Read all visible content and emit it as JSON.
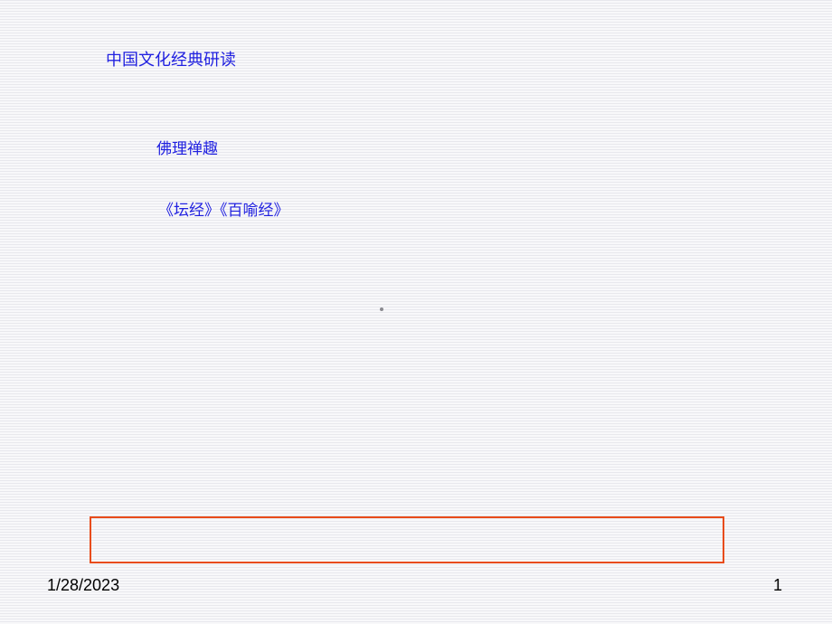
{
  "slide": {
    "title_main": "中国文化经典研读",
    "title_sub1": "佛理禅趣",
    "title_sub2": "《坛经》《百喻经》"
  },
  "footer": {
    "date": "1/28/2023",
    "page_number": "1"
  }
}
